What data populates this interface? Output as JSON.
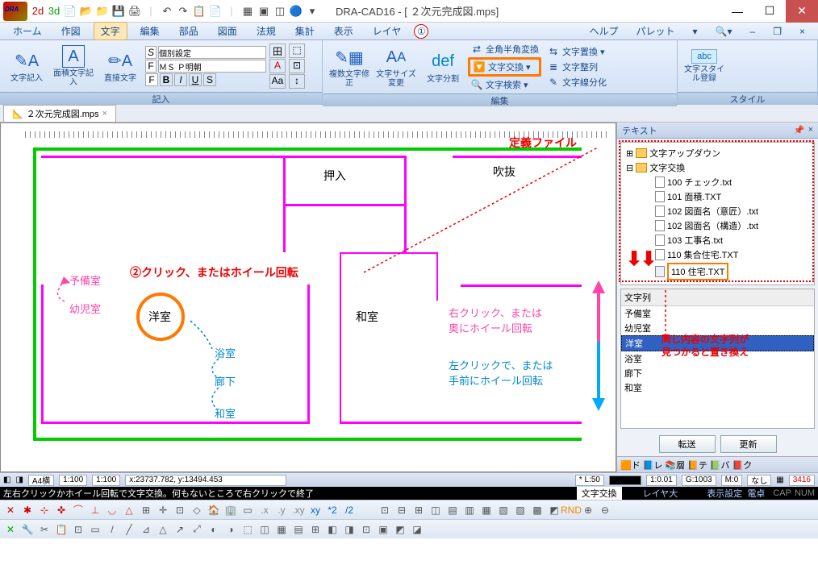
{
  "title": "DRA-CAD16 - [ ２次元完成図.mps]",
  "menus": [
    "ホーム",
    "作図",
    "文字",
    "編集",
    "部品",
    "図面",
    "法規",
    "集計",
    "表示",
    "レイヤ"
  ],
  "menu_right": {
    "help": "ヘルプ",
    "palette": "パレット"
  },
  "ribbon": {
    "group1": {
      "label": "記入",
      "btn1": "文字記入",
      "btn2": "面積文字記入",
      "btn3": "直接文字",
      "font_mode": "個別設定",
      "font_name": "ＭＳ Ｐ明朝"
    },
    "group2": {
      "label": "編集",
      "btn1": "複数文字修正",
      "btn2": "文字サイズ変更",
      "btn3": "文字分割",
      "r1": "全角半角変換",
      "r2": "文字交換",
      "r3": "文字検索",
      "r4": "文字置換",
      "r5": "文字整列",
      "r6": "文字線分化"
    },
    "group3": {
      "label": "スタイル",
      "btn1": "文字スタイル登録"
    }
  },
  "tab": {
    "name": "２次元完成図.mps"
  },
  "canvas": {
    "rooms": {
      "oshiire": "押入",
      "fukinuke": "吹抜",
      "yobi": "予備室",
      "youji": "幼児室",
      "youshitsu": "洋室",
      "washitsu": "和室",
      "yokushitsu": "浴室",
      "rouka": "廊下",
      "washitsu2": "和室"
    },
    "annos": {
      "teigi": "定義ファイル",
      "click": "②クリック、またはホイール回転",
      "right": "右クリック、または\n奥にホイール回転",
      "left": "左クリックで、または\n手前にホイール回転",
      "same": "同じ内容の文字列が\n見つかると置き換え",
      "num1": "①"
    }
  },
  "side": {
    "title": "テキスト",
    "tree": {
      "f1": "文字アップダウン",
      "f2": "文字交換",
      "files": [
        "100 チェック.txt",
        "101 面積.TXT",
        "102 図面名（意匠）.txt",
        "102 図面名（構造）.txt",
        "103 工事名.txt",
        "110 集合住宅.TXT"
      ],
      "selected": "110 住宅.TXT"
    },
    "list": {
      "hdr": "文字列",
      "items": [
        "予備室",
        "幼児室",
        "洋室",
        "浴室",
        "廊下",
        "和室"
      ],
      "sel": "洋室"
    },
    "btns": {
      "b1": "転送",
      "b2": "更新"
    }
  },
  "status": {
    "paper": "A4横",
    "s1": "1:100",
    "s2": "1:100",
    "coords": "x:23737.782, y:13494.453",
    "l50": "* L:50",
    "r1": "1:0.01",
    "r2": "G:1003",
    "r3": "M:0",
    "r4": "なし",
    "r5": "3416",
    "msg": "左右クリックかホイール回転で文字交換。何もないところで右クリックで終了",
    "mode": "文字交換",
    "layer": "レイヤ大",
    "disp": "表示設定",
    "calc": "電卓",
    "cap": "CAP",
    "num": "NUM"
  },
  "side_icons": [
    "ド",
    "レ",
    "層",
    "テ",
    "バ",
    "ク"
  ]
}
